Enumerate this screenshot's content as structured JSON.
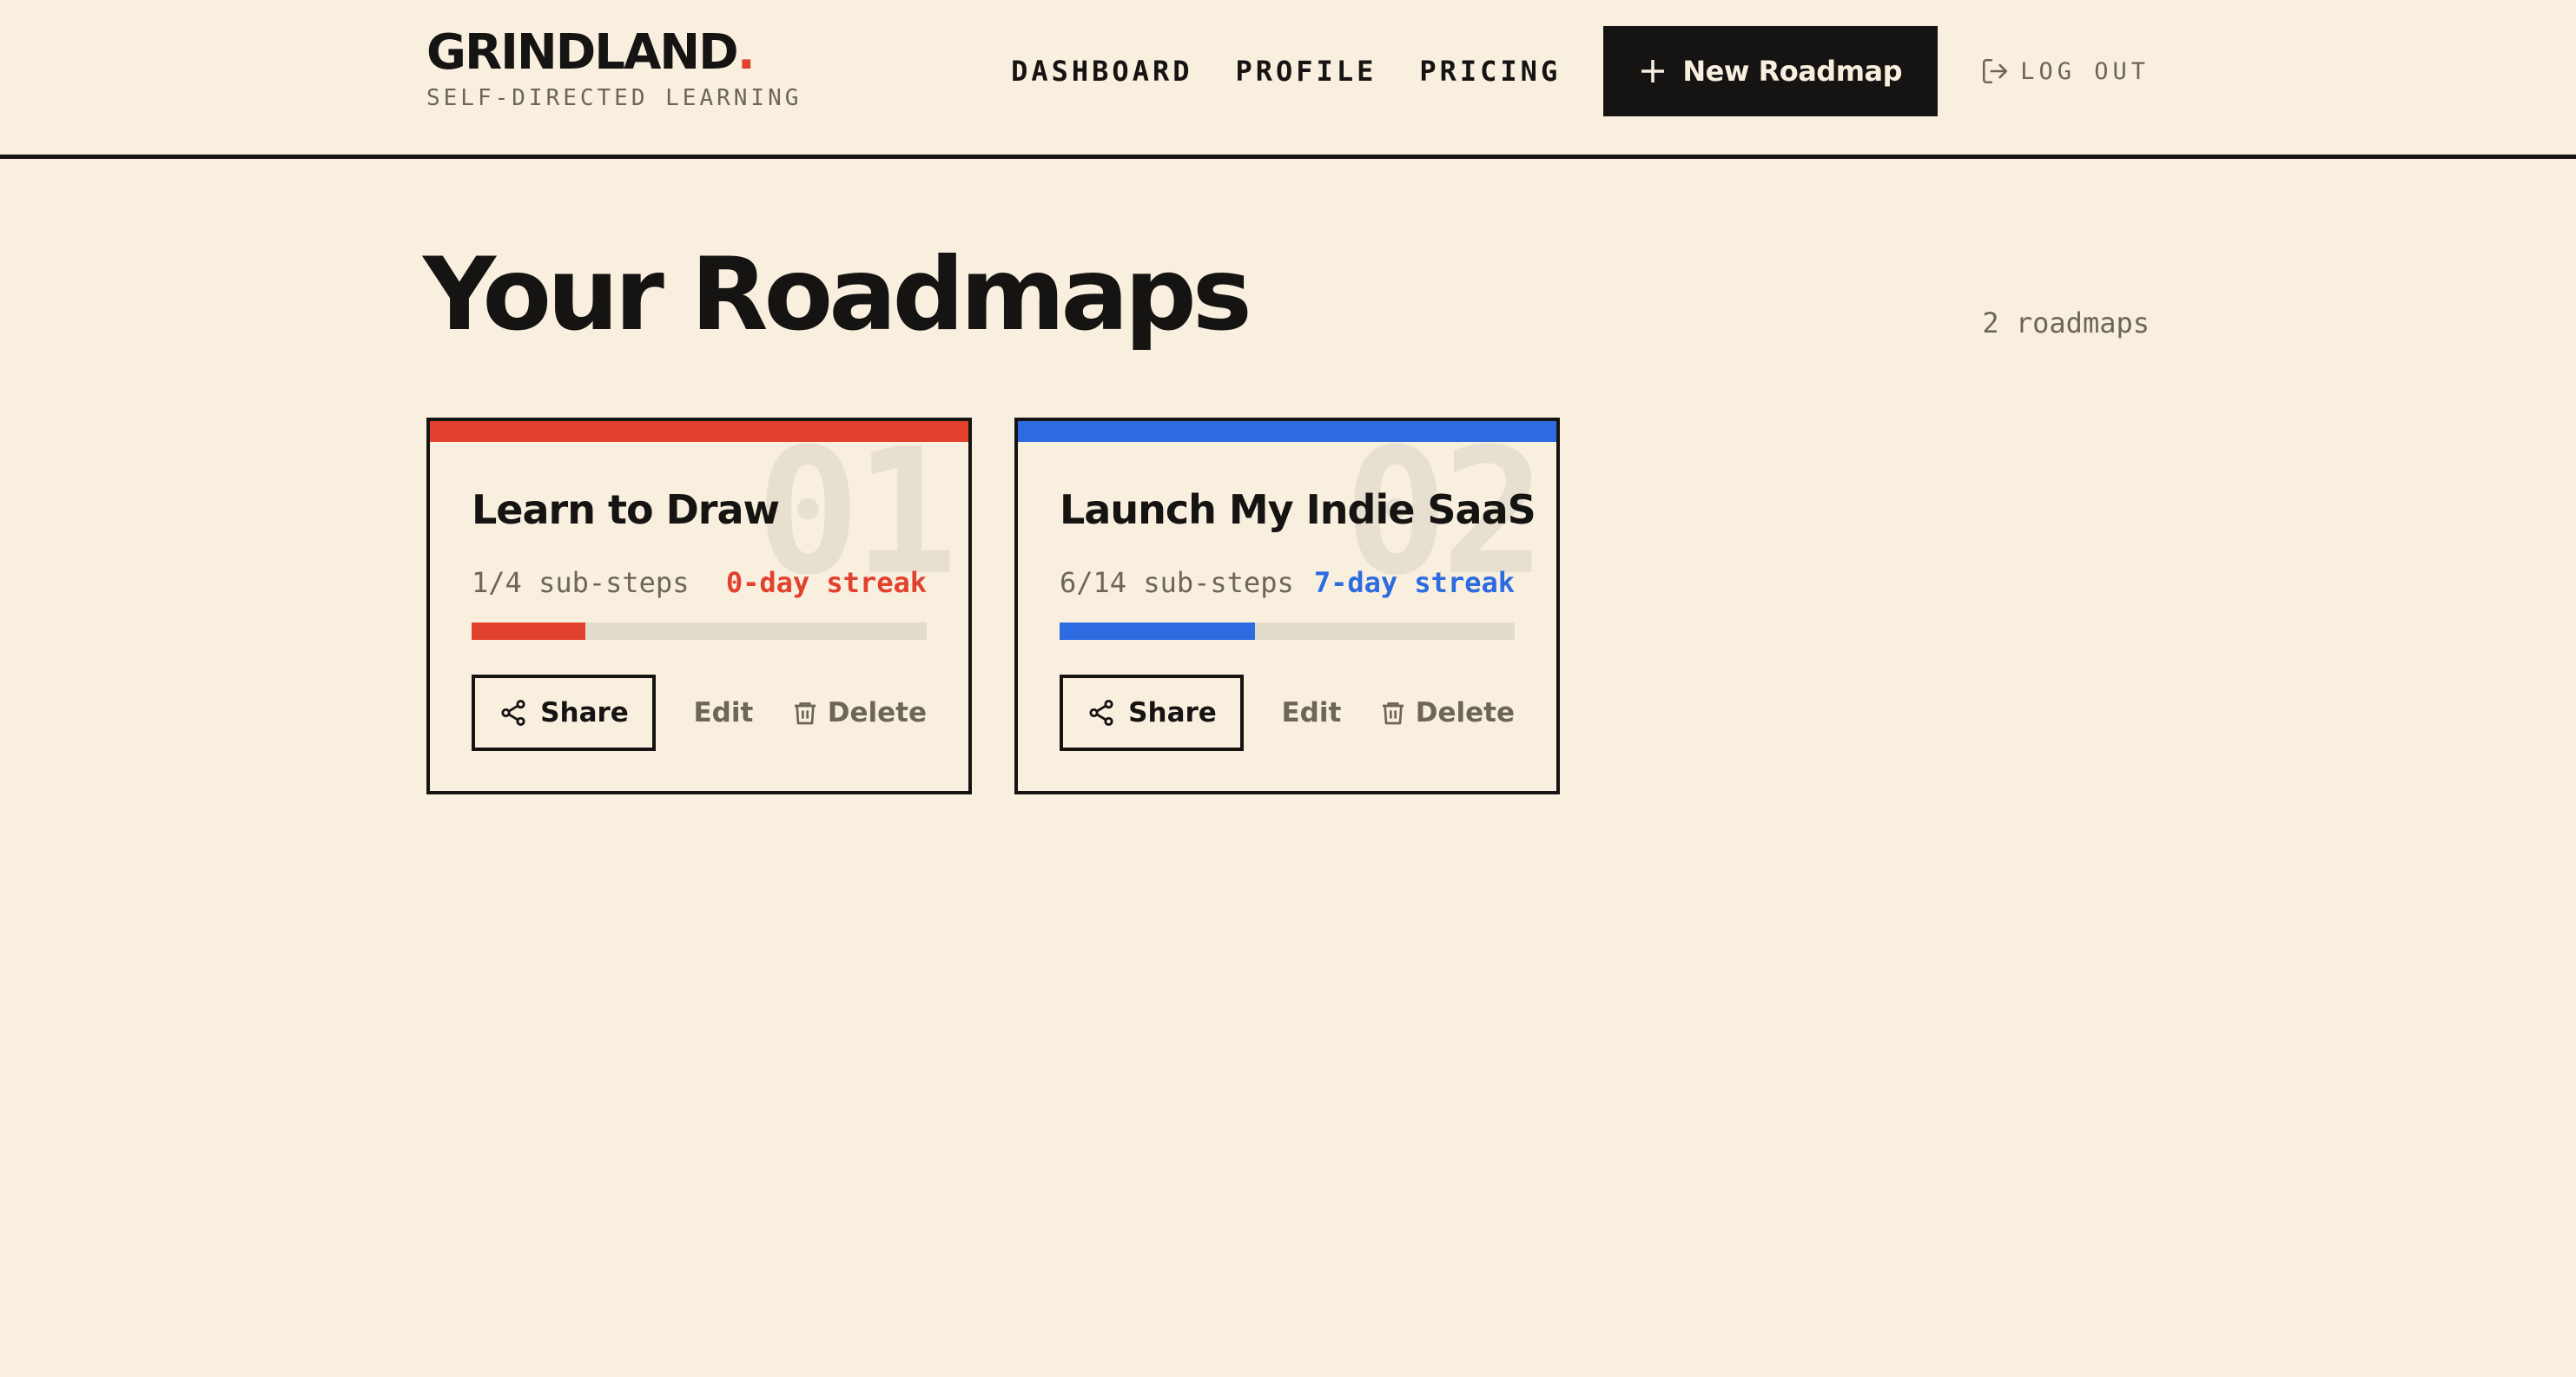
{
  "header": {
    "logo": "GRINDLAND",
    "logo_dot": ".",
    "tagline": "SELF-DIRECTED LEARNING",
    "nav": [
      "DASHBOARD",
      "PROFILE",
      "PRICING"
    ],
    "new_button": "New Roadmap",
    "logout": "LOG OUT"
  },
  "main": {
    "title": "Your Roadmaps",
    "count": "2 roadmaps"
  },
  "roadmaps": [
    {
      "number": "01",
      "title": "Learn to Draw",
      "substeps": "1/4 sub-steps",
      "streak": "0-day streak",
      "progress": 0.25,
      "accent": "#e2412d",
      "share": "Share",
      "edit": "Edit",
      "delete": "Delete"
    },
    {
      "number": "02",
      "title": "Launch My Indie SaaS",
      "substeps": "6/14 sub-steps",
      "streak": "7-day streak",
      "progress": 0.4286,
      "accent": "#2c6be0",
      "share": "Share",
      "edit": "Edit",
      "delete": "Delete"
    }
  ],
  "colors": {
    "background": "#f8efdf",
    "ink": "#161412",
    "muted": "#6c6558",
    "brand_dot": "#e2412d"
  },
  "icons": [
    "plus-icon",
    "logout-icon",
    "share-icon",
    "trash-icon"
  ]
}
